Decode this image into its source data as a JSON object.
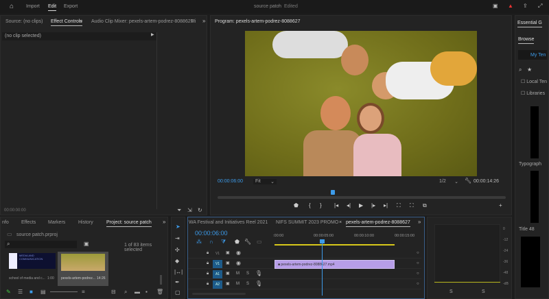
{
  "topbar": {
    "nav": [
      "Import",
      "Edit",
      "Export"
    ],
    "active": "Edit",
    "title": "source patch",
    "status": "Edited"
  },
  "source_panel": {
    "tabs": [
      "Source: (no clips)",
      "Effect Controls",
      "Audio Clip Mixer: pexels-artem-podrez-8088627",
      "Mi"
    ],
    "active_tab": "Effect Controls",
    "no_clip": "(no clip selected)",
    "timecode": "00:00:00:00"
  },
  "program": {
    "title": "Program: pexels-artem-podrez-8088627",
    "timecode": "00:00:06:00",
    "fit": "Fit",
    "resolution": "1/2",
    "duration": "00:00:14:26",
    "playhead_fraction": 0.4
  },
  "project": {
    "tabs": [
      "nfo",
      "Effects",
      "Markers",
      "History",
      "Project: source patch"
    ],
    "active_tab": "Project: source patch",
    "file": "source patch.prproj",
    "selection": "1 of 83 items selected",
    "items": [
      {
        "name": "school of media and c...",
        "duration": "1:00",
        "thumb_text": "MEDIA AND COMMUNICATION"
      },
      {
        "name": "pexels-artem-podrez...",
        "duration": "14:26"
      }
    ]
  },
  "timeline": {
    "tabs": [
      "WA Festival and Initiatives Reel 2021",
      "NIFS SUMMIT 2023 PROMO",
      "pexels-artem-podrez-8088627"
    ],
    "active_tab": "pexels-artem-podrez-8088627",
    "timecode": "00:00:06:00",
    "ruler": [
      ":00:00",
      "00:00:05:00",
      "00:00:10:00",
      "00:00:15:00"
    ],
    "tracks": [
      {
        "id": "V1",
        "type": "video"
      },
      {
        "id": "V1",
        "type": "video",
        "clip": "pexels-artem-podrez-8088627.mp4"
      },
      {
        "id": "A1",
        "type": "audio",
        "m": "M",
        "s": "S"
      },
      {
        "id": "A2",
        "type": "audio",
        "m": "M",
        "s": "S"
      }
    ]
  },
  "meter": {
    "scale": [
      "0",
      "-12",
      "-24",
      "-36",
      "-48",
      "-dB"
    ],
    "solo": [
      "S",
      "S"
    ]
  },
  "essential": {
    "tab": "Essential G",
    "browse": "Browse",
    "my_templates": "My Ten",
    "local": "Local Ten",
    "libraries": "Libraries",
    "typography": "Typograph",
    "title": "Title 48"
  }
}
